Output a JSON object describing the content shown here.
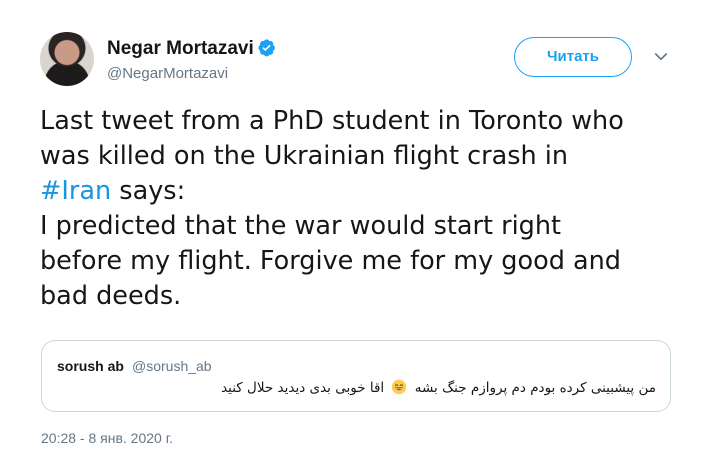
{
  "author": {
    "name": "Negar Mortazavi",
    "handle": "@NegarMortazavi",
    "verified": true
  },
  "follow_button": {
    "label": "Читать"
  },
  "tweet": {
    "text_before": "Last tweet from a PhD student in Toronto who\nwas killed on the Ukrainian flight crash in\n",
    "hashtag": "#Iran",
    "text_after": " says:\nI predicted that the war would start right\nbefore my flight. Forgive me for my good and\nbad deeds."
  },
  "quoted_tweet": {
    "name": "sorush ab",
    "handle": "@sorush_ab",
    "text_part1": "من پیشبینی کرده بودم دم پروازم جنگ بشه",
    "emoji": "grinning-face-emoji",
    "text_part2": "اقا خوبی بدی دیدید حلال کنید"
  },
  "timestamp": "20:28 - 8 янв. 2020 г.",
  "colors": {
    "accent": "#1da1f2",
    "hashtag": "#1b95e0",
    "secondary_text": "#657786",
    "border": "#ccd6dd"
  }
}
